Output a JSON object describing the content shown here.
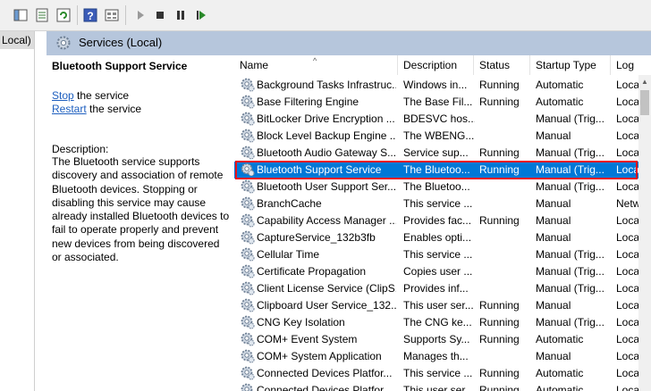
{
  "toolbar": {
    "buttons": [
      "console-icon",
      "properties-icon",
      "refresh-icon",
      "export-icon",
      "help-icon",
      "view-icon",
      "start-icon",
      "stop-icon",
      "pause-icon",
      "restart-icon"
    ]
  },
  "tree": {
    "selected_label": "Local)"
  },
  "header": {
    "title": "Services (Local)"
  },
  "details": {
    "service_title": "Bluetooth Support Service",
    "stop_link": "Stop",
    "stop_suffix": " the service",
    "restart_link": "Restart",
    "restart_suffix": " the service",
    "description_label": "Description:",
    "description_lines": [
      "The Bluetooth service supports",
      "discovery and association of remote",
      "Bluetooth devices.  Stopping or",
      "disabling this service may cause",
      "already installed Bluetooth devices to",
      "fail to operate properly and prevent",
      "new devices from being discovered",
      "or associated."
    ]
  },
  "columns": {
    "name": "Name",
    "description": "Description",
    "status": "Status",
    "startup_type": "Startup Type",
    "log_on_as": "Log"
  },
  "rows": [
    {
      "name": "Background Tasks Infrastruc...",
      "description": "Windows in...",
      "status": "Running",
      "startup": "Automatic",
      "logon": "Loca"
    },
    {
      "name": "Base Filtering Engine",
      "description": "The Base Fil...",
      "status": "Running",
      "startup": "Automatic",
      "logon": "Loca"
    },
    {
      "name": "BitLocker Drive Encryption ...",
      "description": "BDESVC hos...",
      "status": "",
      "startup": "Manual (Trig...",
      "logon": "Loca"
    },
    {
      "name": "Block Level Backup Engine ...",
      "description": "The WBENG...",
      "status": "",
      "startup": "Manual",
      "logon": "Loca"
    },
    {
      "name": "Bluetooth Audio Gateway S...",
      "description": "Service sup...",
      "status": "Running",
      "startup": "Manual (Trig...",
      "logon": "Loca"
    },
    {
      "name": "Bluetooth Support Service",
      "description": "The Bluetoo...",
      "status": "Running",
      "startup": "Manual (Trig...",
      "logon": "Loca"
    },
    {
      "name": "Bluetooth User Support Ser...",
      "description": "The Bluetoo...",
      "status": "",
      "startup": "Manual (Trig...",
      "logon": "Loca"
    },
    {
      "name": "BranchCache",
      "description": "This service ...",
      "status": "",
      "startup": "Manual",
      "logon": "Netw"
    },
    {
      "name": "Capability Access Manager ...",
      "description": "Provides fac...",
      "status": "Running",
      "startup": "Manual",
      "logon": "Loca"
    },
    {
      "name": "CaptureService_132b3fb",
      "description": "Enables opti...",
      "status": "",
      "startup": "Manual",
      "logon": "Loca"
    },
    {
      "name": "Cellular Time",
      "description": "This service ...",
      "status": "",
      "startup": "Manual (Trig...",
      "logon": "Loca"
    },
    {
      "name": "Certificate Propagation",
      "description": "Copies user ...",
      "status": "",
      "startup": "Manual (Trig...",
      "logon": "Loca"
    },
    {
      "name": "Client License Service (ClipS...",
      "description": "Provides inf...",
      "status": "",
      "startup": "Manual (Trig...",
      "logon": "Loca"
    },
    {
      "name": "Clipboard User Service_132...",
      "description": "This user ser...",
      "status": "Running",
      "startup": "Manual",
      "logon": "Loca"
    },
    {
      "name": "CNG Key Isolation",
      "description": "The CNG ke...",
      "status": "Running",
      "startup": "Manual (Trig...",
      "logon": "Loca"
    },
    {
      "name": "COM+ Event System",
      "description": "Supports Sy...",
      "status": "Running",
      "startup": "Automatic",
      "logon": "Loca"
    },
    {
      "name": "COM+ System Application",
      "description": "Manages th...",
      "status": "",
      "startup": "Manual",
      "logon": "Loca"
    },
    {
      "name": "Connected Devices Platfor...",
      "description": "This service ...",
      "status": "Running",
      "startup": "Automatic",
      "logon": "Loca"
    },
    {
      "name": "Connected Devices Platfor...",
      "description": "This user ser...",
      "status": "Running",
      "startup": "Automatic",
      "logon": "Loca"
    }
  ],
  "selected_row_index": 5
}
